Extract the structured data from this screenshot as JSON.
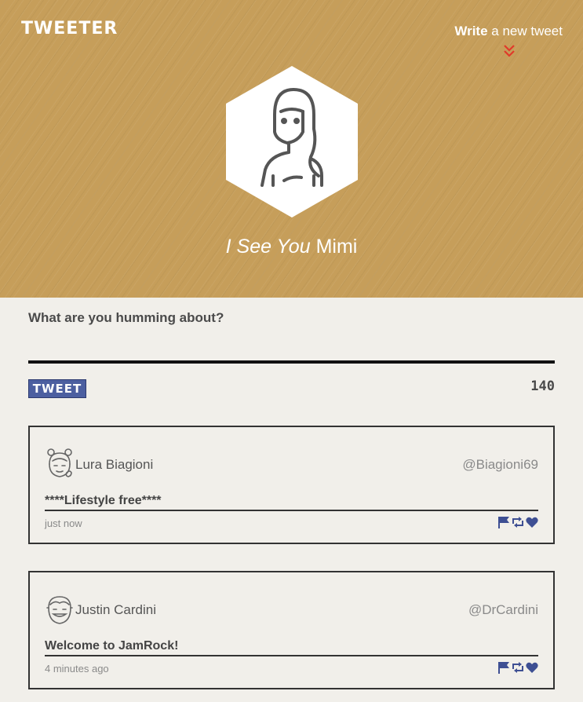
{
  "header": {
    "brand": "TWEETER",
    "write_bold": "Write",
    "write_rest": " a new tweet",
    "icons": {
      "toggle": "chevron-double-down-icon"
    }
  },
  "profile": {
    "name_prefix": "I See You",
    "name": "Mimi",
    "avatar_icon": "woman-avatar-icon"
  },
  "compose": {
    "prompt": "What are you humming about?",
    "button_label": "TWEET",
    "counter": "140"
  },
  "tweets": [
    {
      "name": "Lura Biagioni",
      "handle": "@Biagioni69",
      "content": "****Lifestyle free****",
      "time": "just now",
      "avatar_icon": "girl-avatar-icon"
    },
    {
      "name": "Justin Cardini",
      "handle": "@DrCardini",
      "content": "Welcome to JamRock!",
      "time": "4 minutes ago",
      "avatar_icon": "boy-avatar-icon"
    }
  ],
  "colors": {
    "hero": "#c69e5a",
    "background": "#f1efea",
    "accent": "#4c5fa0",
    "chevron": "#e03a2a"
  }
}
